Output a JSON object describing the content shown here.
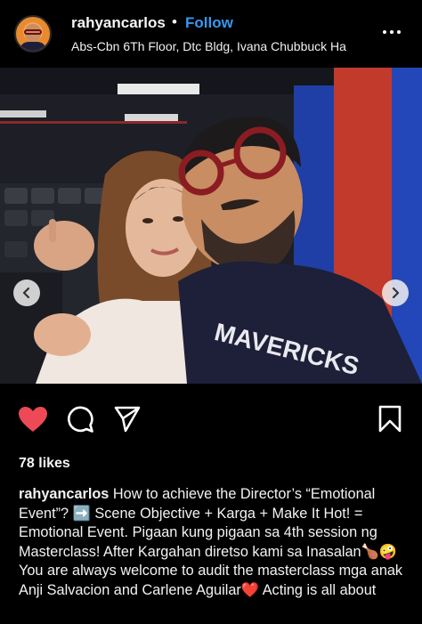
{
  "header": {
    "username": "rahyancarlos",
    "separator": "•",
    "follow_label": "Follow",
    "location": "Abs-Cbn 6Th Floor, Dtc Bldg, Ivana Chubbuck Ha"
  },
  "post": {
    "icons": {
      "more": "more-options-icon",
      "prev": "chevron-left-icon",
      "next": "chevron-right-icon",
      "tagged": "person-tag-icon",
      "like": "heart-icon",
      "comment": "comment-icon",
      "share": "send-icon",
      "save": "bookmark-icon"
    },
    "carousel": {
      "count": 3,
      "active_index": 1
    },
    "liked": true,
    "like_color": "#ed4956",
    "accent_color": "#3897f0",
    "likes_text": "78 likes",
    "caption_user": "rahyancarlos",
    "caption_text": "How to achieve the Director’s “Emotional Event”? ➡️ Scene Objective + Karga + Make It Hot! = Emotional Event. Pigaan kung pigaan sa 4th session ng Masterclass! After Kargahan diretso kami sa Inasalan🍗🤪 You are always welcome to audit the masterclass mga anak Anji Salvacion and Carlene Aguilar❤️ Acting is all about"
  }
}
